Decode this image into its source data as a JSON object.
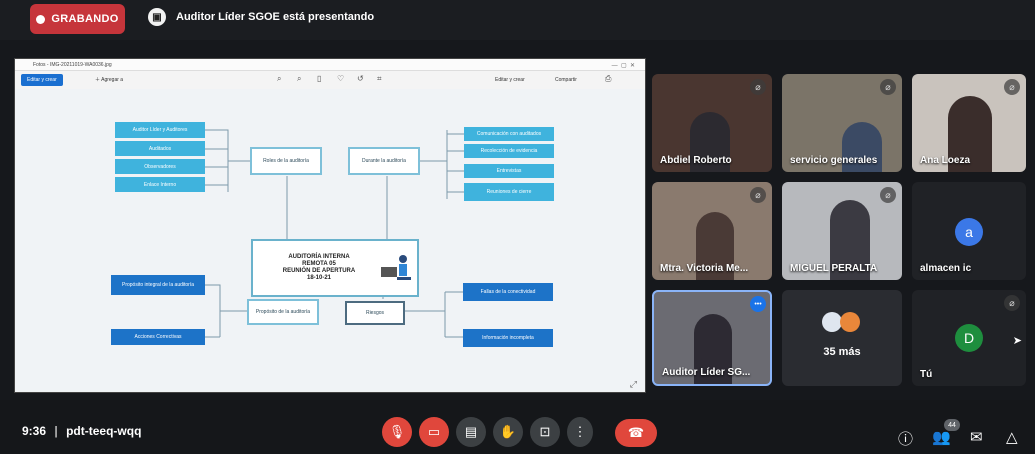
{
  "top": {
    "recording": "GRABANDO",
    "presenter_text": "Auditor Líder SGOE está presentando"
  },
  "shared_window": {
    "title": "Fotos - IMG-20211019-WA0036.jpg",
    "edit_button": "Editar y crear",
    "add_to": "Agregar a",
    "edit_create": "Editar y crear",
    "share": "Compartir"
  },
  "mindmap": {
    "center": [
      "AUDITORÍA INTERNA",
      "REMOTA 05",
      "REUNIÓN DE APERTURA",
      "18-10-21"
    ],
    "roles": "Roles de la auditoría",
    "durante": "Durante la auditoría",
    "proposito": "Propósito de la auditoría",
    "riesgos": "Riesgos",
    "left_top": [
      "Auditor Líder y Auditores",
      "Auditados",
      "Observadores",
      "Enlace Interno"
    ],
    "right_top": [
      "Comunicación con auditados",
      "Recolección de evidencia",
      "Entrevistas",
      "Reuniones de cierre"
    ],
    "left_bottom": [
      "Propósito integral de la auditoría",
      "Acciones Correctivas"
    ],
    "right_bottom": [
      "Fallas de la conectividad",
      "Información incompleta"
    ]
  },
  "tiles": [
    {
      "name": "Abdiel Roberto",
      "muted": true
    },
    {
      "name": "servicio generales",
      "muted": true
    },
    {
      "name": "Ana Loeza",
      "muted": true
    },
    {
      "name": "Mtra. Victoria Me...",
      "muted": true
    },
    {
      "name": "MIGUEL PERALTA",
      "muted": true
    },
    {
      "name": "almacen ic",
      "muted": false,
      "avatar": "a",
      "avatar_color": "#3b78e7"
    },
    {
      "name": "Auditor Líder SG...",
      "muted": false,
      "options": "•••"
    },
    {
      "name": "35 más",
      "muted": false
    },
    {
      "name": "Tú",
      "muted": true,
      "avatar": "D",
      "avatar_color": "#1e8e3e"
    }
  ],
  "bottom": {
    "time": "9:36",
    "separator": "|",
    "meeting_code": "pdt-teeq-wqq",
    "participants_count": "44"
  },
  "icons": {
    "mic_off": "mic-off-icon",
    "cam_off": "camera-off-icon",
    "captions": "captions-icon",
    "hand": "raise-hand-icon",
    "present": "present-icon",
    "more": "more-options-icon",
    "hangup": "hang-up-icon",
    "info": "info-icon",
    "people": "people-icon",
    "chat": "chat-icon",
    "activities": "activities-icon"
  },
  "colors": {
    "recording_red": "#c6353b",
    "end_call_red": "#e0473c",
    "mindmap_cyan": "#3fb3dd",
    "mindmap_blue": "#1d73c8"
  }
}
